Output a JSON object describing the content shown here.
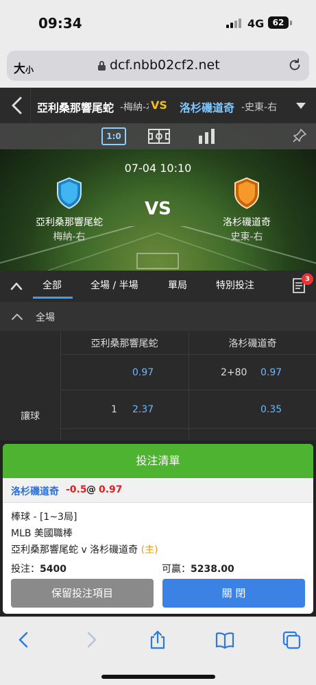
{
  "status_bar": {
    "time": "09:34",
    "network": "4G",
    "battery": "62"
  },
  "browser": {
    "text_size_label": "大",
    "text_size_small": "小",
    "url": "dcf.nbb02cf2.net"
  },
  "match_header": {
    "home_team": "亞利桑那響尾蛇",
    "home_pitcher": "-梅納-右",
    "vs": "VS",
    "away_team": "洛杉磯道奇",
    "away_pitcher": "-史東-右"
  },
  "banner": {
    "score_view_label": "1:0",
    "kickoff": "07-04 10:10",
    "vs": "VS",
    "home_team": "亞利桑那響尾蛇",
    "home_pitcher": "梅納-右",
    "away_team": "洛杉磯道奇",
    "away_pitcher": "史東-右",
    "home_color": "#2fa8e8",
    "away_color": "#f08a1c"
  },
  "tabs": {
    "items": [
      "全部",
      "全場 / 半場",
      "單局",
      "特別投注"
    ],
    "active": 0,
    "betslip_count": "3"
  },
  "section": {
    "title": "全場",
    "columns": [
      "亞利桑那響尾蛇",
      "洛杉磯道奇"
    ],
    "market_label": "讓球",
    "rows": [
      {
        "home_line": "",
        "home_odds": "0.97",
        "away_line": "2+80",
        "away_odds": "0.97"
      },
      {
        "home_line": "1",
        "home_odds": "2.37",
        "away_line": "",
        "away_odds": "0.35"
      }
    ]
  },
  "betslip": {
    "title": "投注清單",
    "selection_team": "洛杉磯道奇",
    "selection_handicap": "-0.5",
    "selection_at": "@",
    "selection_odds": "0.97",
    "sport_line": "棒球 - [1~3局]",
    "league": "MLB 美國職棒",
    "match": "亞利桑那響尾蛇 v 洛杉磯道奇",
    "home_tag": "(主)",
    "stake_label": "投注：",
    "stake_value": "5400",
    "win_label": "可贏：",
    "win_value": "5238.00",
    "keep_button": "保留投注項目",
    "close_button": "關 閉"
  },
  "colors": {
    "accent_green": "#4db330",
    "accent_blue": "#3b82e4",
    "odds_blue": "#6ab8ff",
    "highlight_red": "#e02020"
  }
}
